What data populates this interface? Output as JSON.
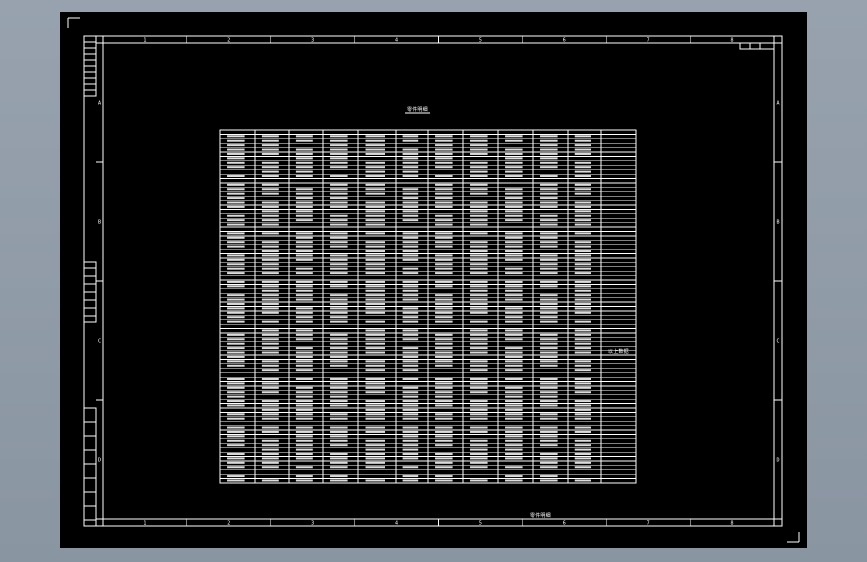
{
  "drawing": {
    "column_labels": [
      "1",
      "2",
      "3",
      "4",
      "5",
      "6",
      "7",
      "8"
    ],
    "row_labels": [
      "A",
      "B",
      "C",
      "D"
    ],
    "table_title": "零件明细",
    "footer_text": "零件明细",
    "annotation": "以上数据"
  }
}
